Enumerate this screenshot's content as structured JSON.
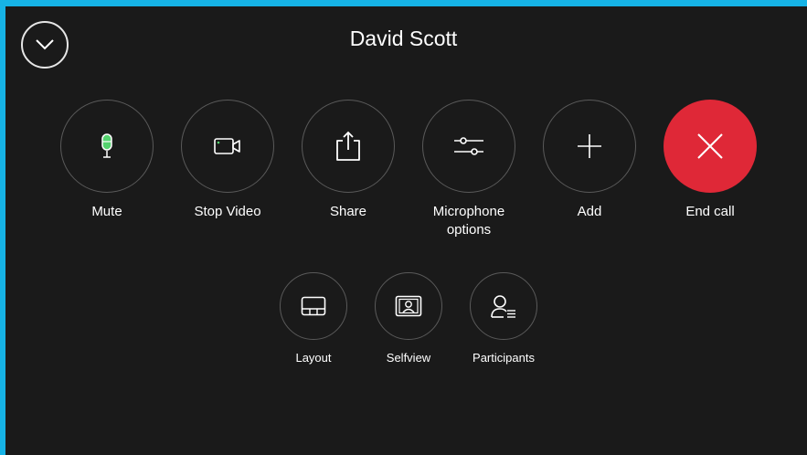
{
  "call": {
    "title": "David Scott"
  },
  "colors": {
    "frame": "#16b3e6",
    "background": "#1a1a1a",
    "end_call": "#df2837",
    "mic_active": "#54d26e"
  },
  "actions": [
    {
      "label": "Mute",
      "icon": "microphone-icon"
    },
    {
      "label": "Stop Video",
      "icon": "camera-icon"
    },
    {
      "label": "Share",
      "icon": "share-icon"
    },
    {
      "label": "Microphone\noptions",
      "icon": "sliders-icon"
    },
    {
      "label": "Add",
      "icon": "plus-icon"
    },
    {
      "label": "End call",
      "icon": "close-icon"
    }
  ],
  "secondary_actions": [
    {
      "label": "Layout",
      "icon": "layout-icon"
    },
    {
      "label": "Selfview",
      "icon": "selfview-icon"
    },
    {
      "label": "Participants",
      "icon": "participants-icon"
    }
  ]
}
